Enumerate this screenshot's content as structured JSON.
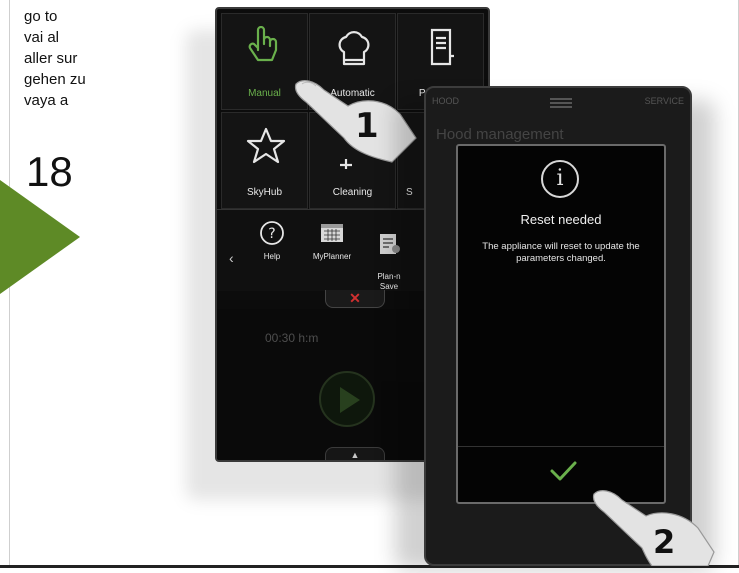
{
  "instructions": {
    "goto_lines": [
      "go to",
      "vai al",
      "aller sur",
      "gehen zu",
      "vaya a"
    ],
    "page_number": "18"
  },
  "phone_main": {
    "tiles": [
      {
        "label": "Manual",
        "icon": "hand-pointer-icon",
        "active": true
      },
      {
        "label": "Automatic",
        "icon": "chef-hat-icon"
      },
      {
        "label": "Programs",
        "icon": "book-icon"
      },
      {
        "label": "SkyHub",
        "icon": "star-icon"
      },
      {
        "label": "Cleaning",
        "icon": "sparkle-icon"
      },
      {
        "label": "S",
        "icon": "partial-icon"
      }
    ],
    "menu_items": [
      {
        "label": "Help",
        "icon": "question-icon"
      },
      {
        "label": "MyPlanner",
        "icon": "calendar-icon"
      },
      {
        "label": "Plan-n\nSave",
        "icon": "clipboard-icon"
      }
    ],
    "close_symbol": "✕",
    "timer": "00:30 h:m",
    "up_symbol": "▲"
  },
  "phone_dialog": {
    "top_left": "HOOD",
    "top_right": "SERVICE",
    "screen_title": "Hood management",
    "dialog_title": "Reset needed",
    "dialog_message": "The appliance will reset to update the parameters changed.",
    "confirm_icon": "checkmark-icon"
  },
  "steps": {
    "step1": "1",
    "step2": "2"
  },
  "colors": {
    "accent_green": "#6ab04c",
    "arrow_green": "#5e8a26",
    "close_red": "#d13030"
  }
}
